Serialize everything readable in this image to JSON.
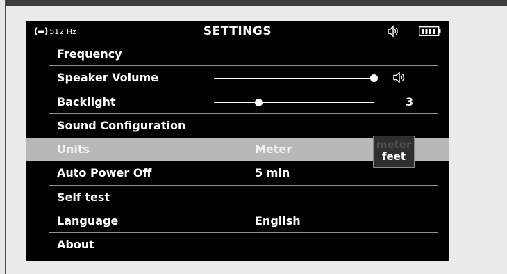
{
  "status_bar": {
    "signal_icon": "signal-wave-icon",
    "frequency": "512 Hz",
    "title": "SETTINGS",
    "speaker_icon": "speaker-icon",
    "battery_icon": "battery-icon"
  },
  "menu": {
    "items": [
      {
        "label": "Frequency",
        "value": ""
      },
      {
        "label": "Speaker Volume",
        "value": "",
        "slider_level": 1.0
      },
      {
        "label": "Backlight",
        "value": "3",
        "slider_level": 0.28
      },
      {
        "label": "Sound Configuration",
        "value": ""
      },
      {
        "label": "Units",
        "value": "Meter",
        "selected": true
      },
      {
        "label": "Auto Power Off",
        "value": "5 min"
      },
      {
        "label": "Self test",
        "value": ""
      },
      {
        "label": "Language",
        "value": "English"
      },
      {
        "label": "About",
        "value": ""
      }
    ]
  },
  "units_dropdown": {
    "options": [
      "meter",
      "feet"
    ],
    "highlighted": "feet"
  },
  "colors": {
    "screen_bg": "#000000",
    "selected_row_bg": "#b8b8b8",
    "page_bg": "#ebebeb"
  }
}
